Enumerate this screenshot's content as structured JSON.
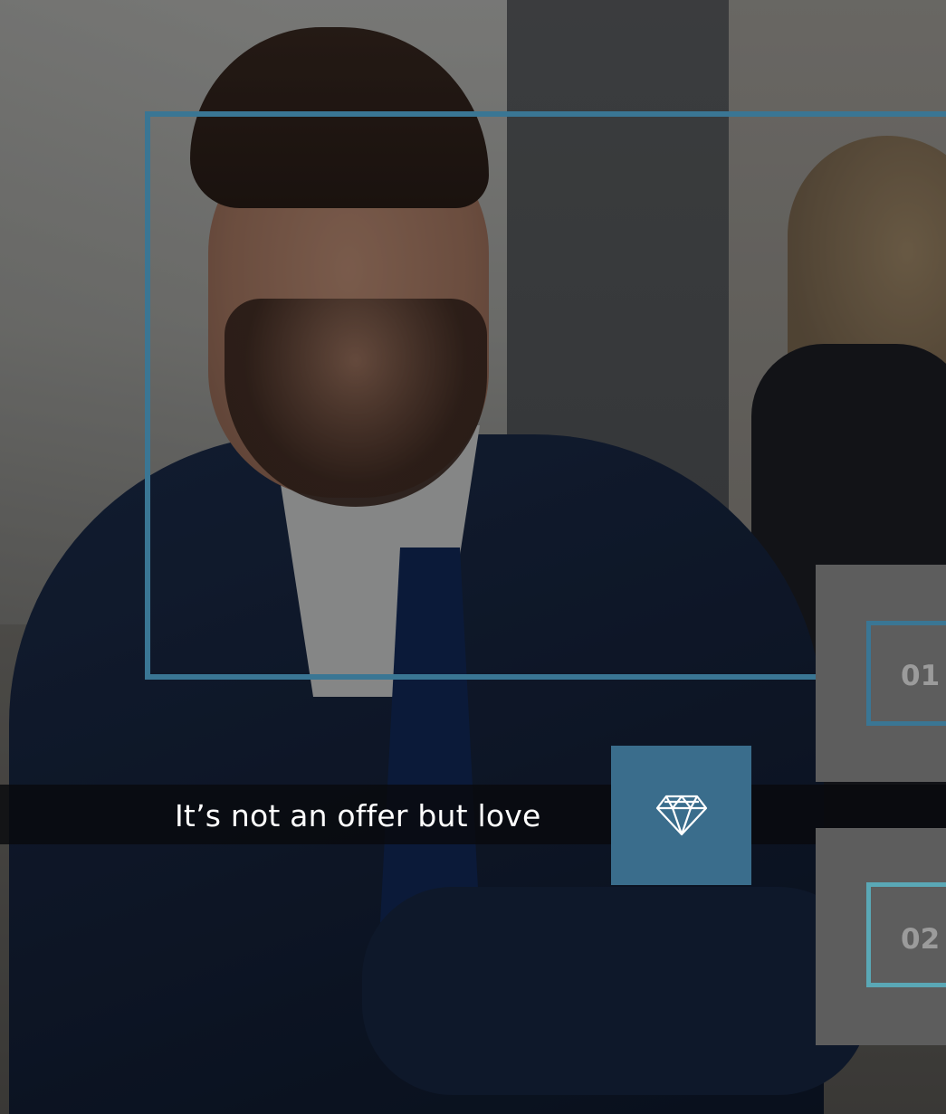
{
  "caption": {
    "text": "It’s not an offer but love"
  },
  "badge": {
    "icon": "diamond-icon"
  },
  "cards": [
    {
      "number": "01"
    },
    {
      "number": "02"
    }
  ],
  "colors": {
    "accent_frame": "#3a7694",
    "accent_frame_light": "#5aa8b6",
    "icon_box": "#3a6d8c",
    "card_bg": "#5d5d5d",
    "number_text": "#9b9b9b",
    "band_bg": "#080a0e"
  }
}
